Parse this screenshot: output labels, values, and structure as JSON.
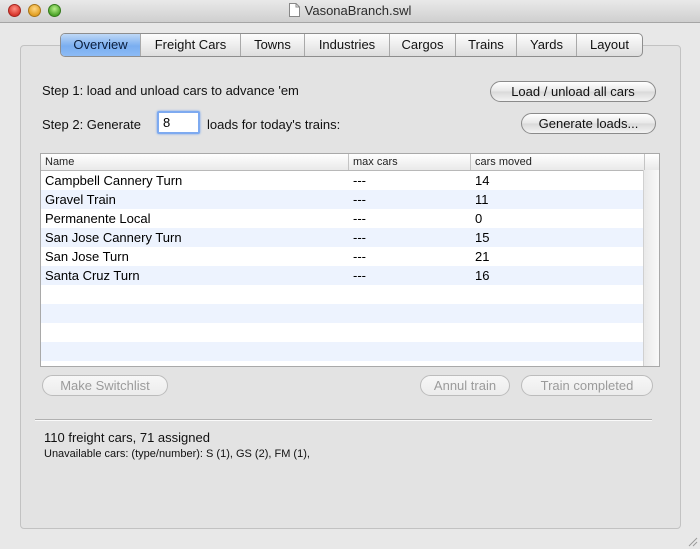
{
  "window": {
    "title": "VasonaBranch.swl"
  },
  "tabs": [
    {
      "label": "Overview",
      "selected": true
    },
    {
      "label": "Freight Cars",
      "selected": false
    },
    {
      "label": "Towns",
      "selected": false
    },
    {
      "label": "Industries",
      "selected": false
    },
    {
      "label": "Cargos",
      "selected": false
    },
    {
      "label": "Trains",
      "selected": false
    },
    {
      "label": "Yards",
      "selected": false
    },
    {
      "label": "Layout",
      "selected": false
    }
  ],
  "overview": {
    "step1_label": "Step 1: load and unload cars to advance 'em",
    "load_unload_button": "Load / unload all cars",
    "step2_prefix": "Step 2: Generate",
    "loads_count": "8",
    "step2_suffix": "loads for today's trains:",
    "generate_button": "Generate loads..."
  },
  "trains_table": {
    "columns": [
      "Name",
      "max cars",
      "cars moved"
    ],
    "rows": [
      {
        "name": "Campbell Cannery Turn",
        "max_cars": "---",
        "cars_moved": "14"
      },
      {
        "name": "Gravel Train",
        "max_cars": "---",
        "cars_moved": "11"
      },
      {
        "name": "Permanente Local",
        "max_cars": "---",
        "cars_moved": "0"
      },
      {
        "name": "San Jose Cannery Turn",
        "max_cars": "---",
        "cars_moved": "15"
      },
      {
        "name": "San Jose Turn",
        "max_cars": "---",
        "cars_moved": "21"
      },
      {
        "name": "Santa Cruz Turn",
        "max_cars": "---",
        "cars_moved": "16"
      }
    ]
  },
  "actions": {
    "make_switchlist": "Make Switchlist",
    "annul_train": "Annul train",
    "train_completed": "Train completed"
  },
  "status": {
    "summary": "110 freight cars, 71 assigned",
    "unavailable": "Unavailable cars: (type/number): S (1), GS (2), FM (1),"
  },
  "colors": {
    "selection_blue": "#7aaef0",
    "row_alt": "#edf3fe"
  }
}
